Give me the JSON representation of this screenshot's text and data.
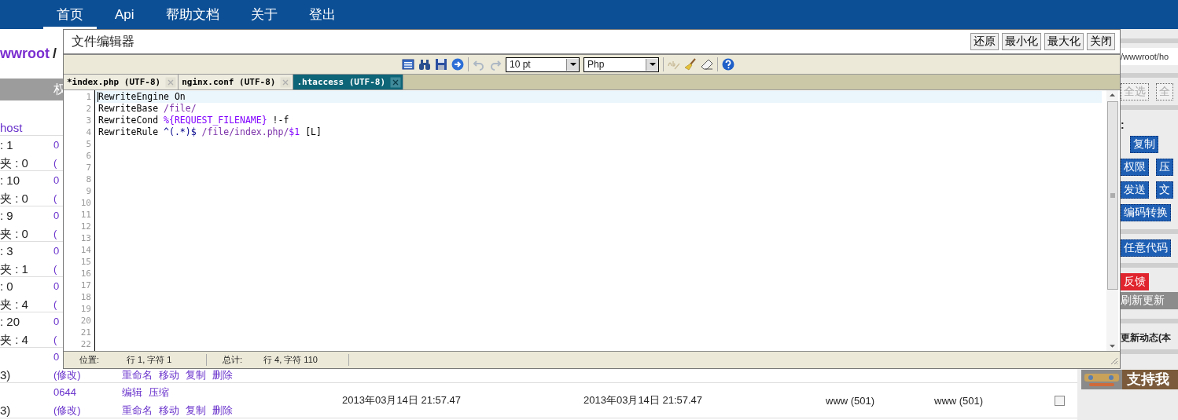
{
  "nav": {
    "items": [
      {
        "label": "首页",
        "selected": true
      },
      {
        "label": "Api",
        "selected": false
      },
      {
        "label": "帮助文档",
        "selected": false
      },
      {
        "label": "关于",
        "selected": false
      },
      {
        "label": "登出",
        "selected": false
      }
    ]
  },
  "breadcrumb": [
    "wwroot",
    "/"
  ],
  "table": {
    "header": [
      "权"
    ],
    "rows": [
      {
        "name": [
          "host"
        ],
        "perm": []
      },
      {
        "name": [
          ": 1",
          "夹 : 0"
        ],
        "perm": [
          "0",
          "("
        ]
      },
      {
        "name": [
          ": 10",
          "夹 : 0"
        ],
        "perm": [
          "0",
          "("
        ]
      },
      {
        "name": [
          ": 9",
          "夹 : 0"
        ],
        "perm": [
          "0",
          "("
        ]
      },
      {
        "name": [
          ": 3",
          "夹 : 1"
        ],
        "perm": [
          "0",
          "("
        ]
      },
      {
        "name": [
          ": 0",
          "夹 : 4"
        ],
        "perm": [
          "0",
          "("
        ]
      },
      {
        "name": [
          ": 20",
          "夹 : 4"
        ],
        "perm": [
          "0",
          "("
        ]
      },
      {
        "name": [
          "3)"
        ],
        "perm": [
          "0",
          "(修改)"
        ],
        "actions": [
          [
            "重命名",
            "移动",
            "复制",
            "删除"
          ]
        ]
      },
      {
        "name": [
          "3)"
        ],
        "perm": [
          "0644",
          "(修改)"
        ],
        "actions": [
          [
            "编辑",
            "压缩"
          ],
          [
            "重命名",
            "移动",
            "复制",
            "删除"
          ]
        ],
        "created": "2013年03月14日 21:57.47",
        "modified": "2013年03月14日 21:57.47",
        "owner": "www (501)",
        "group": "www (501)",
        "checked": false
      }
    ]
  },
  "right_panel": {
    "address": "/wwwroot/ho",
    "select_buttons": [
      "全选",
      "全"
    ],
    "label": ":",
    "action_rows": [
      [
        "复制"
      ],
      [
        "权限",
        "压"
      ],
      [
        "发送",
        "文"
      ],
      [
        "编码转换"
      ]
    ],
    "custom": "任意代码",
    "feedback": "反馈",
    "refresh": "刷新更新",
    "updates": "更新动态(本",
    "banner": "支持我"
  },
  "editor": {
    "title": "文件编辑器",
    "window_buttons": [
      "还原",
      "最小化",
      "最大化",
      "关闭"
    ],
    "toolbar": [
      {
        "kind": "list",
        "disabled": false
      },
      {
        "kind": "find",
        "disabled": false
      },
      {
        "kind": "save",
        "disabled": false
      },
      {
        "kind": "go",
        "disabled": false
      },
      {
        "kind": "undo",
        "disabled": true
      },
      {
        "kind": "redo",
        "disabled": true
      },
      {
        "kind": "select",
        "value": "10 pt"
      },
      {
        "kind": "select",
        "value": "Php"
      },
      {
        "kind": "spell",
        "disabled": true
      },
      {
        "kind": "brush",
        "disabled": false
      },
      {
        "kind": "eraser",
        "disabled": false
      },
      {
        "kind": "help",
        "disabled": false
      }
    ],
    "tabs": [
      {
        "label": "*index.php (UTF-8)",
        "selected": false
      },
      {
        "label": "nginx.conf (UTF-8)",
        "selected": false
      },
      {
        "label": ".htaccess (UTF-8)",
        "selected": true
      }
    ],
    "code": [
      [
        {
          "kind": "plain",
          "text": "RewriteEngine On"
        }
      ],
      [
        {
          "kind": "plain",
          "text": "RewriteBase "
        },
        {
          "kind": "path",
          "text": "/file/"
        }
      ],
      [
        {
          "kind": "plain",
          "text": "RewriteCond "
        },
        {
          "kind": "var",
          "text": "%{REQUEST_FILENAME}"
        },
        {
          "kind": "plain",
          "text": " !-f"
        }
      ],
      [
        {
          "kind": "plain",
          "text": "RewriteRule "
        },
        {
          "kind": "regex",
          "text": "^(.*)$"
        },
        {
          "kind": "path",
          "text": " /file/index.php/"
        },
        {
          "kind": "var",
          "text": "$1"
        },
        {
          "kind": "plain",
          "text": " [L]"
        }
      ]
    ],
    "line_numbers": [
      "1",
      "2",
      "3",
      "4",
      "5",
      "6",
      "7",
      "8",
      "9",
      "10",
      "11",
      "12",
      "13",
      "14",
      "15",
      "16",
      "17",
      "18",
      "19",
      "20",
      "21",
      "22"
    ],
    "status": {
      "position_label": "位置:",
      "position": "行 1, 字符 1",
      "total_label": "总计:",
      "total": "行 4, 字符 110"
    }
  }
}
